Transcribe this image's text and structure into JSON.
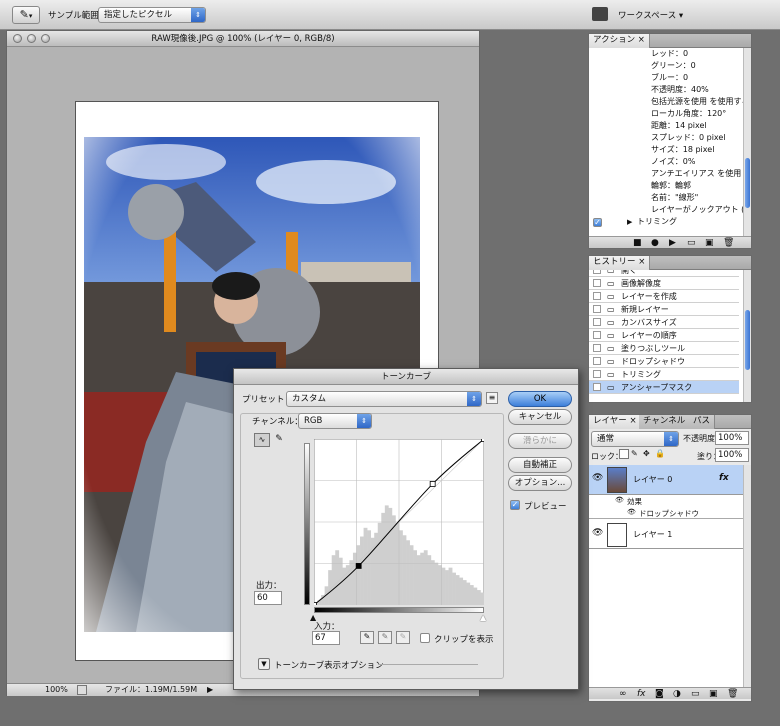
{
  "options_bar": {
    "sample_label": "サンプル範囲：",
    "sample_value": "指定したピクセル",
    "workspace_label": "ワークスペース ▾"
  },
  "document": {
    "title": "RAW現像後.JPG @ 100% (レイヤー 0, RGB/8)",
    "zoom": "100%",
    "file_info": "ファイル：1.19M/1.59M"
  },
  "actions_panel": {
    "tab_label": "アクション",
    "rows": [
      "レッド：0",
      "グリーン：0",
      "ブルー：0",
      "不透明度：40%",
      "包括光源を使用 を使用する",
      "ローカル角度：120°",
      "距離：14 pixel",
      "スプレッド：0 pixel",
      "サイズ：18 pixel",
      "ノイズ：0%",
      "アンチエイリアス を使用し...",
      "輪郭：輪郭",
      "名前：\"線形\"",
      "レイヤーがノックアウト (抜..."
    ],
    "action_item": "トリミング"
  },
  "history_panel": {
    "tab_label": "ヒストリー",
    "items": [
      "開く",
      "画像解像度",
      "レイヤーを作成",
      "新規レイヤー",
      "カンバスサイズ",
      "レイヤーの順序",
      "塗りつぶしツール",
      "ドロップシャドウ",
      "トリミング",
      "アンシャープマスク"
    ],
    "selected_index": 9
  },
  "layers_panel": {
    "tabs": [
      "レイヤー",
      "チャンネル",
      "パス"
    ],
    "blend_mode": "通常",
    "opacity_label": "不透明度：",
    "opacity_value": "100%",
    "lock_label": "ロック：",
    "fill_label": "塗り：",
    "fill_value": "100%",
    "layer0_name": "レイヤー 0",
    "fx_label": "fx",
    "effects_label": "効果",
    "dropshadow_label": "ドロップシャドウ",
    "layer1_name": "レイヤー 1"
  },
  "curves_dialog": {
    "title": "トーンカーブ",
    "preset_label": "プリセット：",
    "preset_value": "カスタム",
    "channel_label": "チャンネル：",
    "channel_value": "RGB",
    "output_label": "出力：",
    "output_value": "60",
    "input_label": "入力：",
    "input_value": "67",
    "clip_label": "クリップを表示",
    "options_label": "トーンカーブ表示オプション",
    "buttons": {
      "ok": "OK",
      "cancel": "キャンセル",
      "smooth": "滑らかに",
      "auto": "自動補正",
      "options": "オプション..."
    },
    "preview_label": "プレビュー",
    "preview_checked": true
  },
  "chart_data": {
    "type": "line",
    "xlabel": "",
    "ylabel": "",
    "xlim": [
      0,
      255
    ],
    "ylim": [
      0,
      255
    ],
    "curve_points": [
      [
        0,
        0
      ],
      [
        67,
        60
      ],
      [
        178,
        186
      ],
      [
        255,
        255
      ]
    ],
    "histogram_series": [
      {
        "values": [
          2,
          4,
          8,
          15,
          28,
          40,
          44,
          38,
          30,
          32,
          36,
          42,
          48,
          55,
          62,
          60,
          54,
          58,
          66,
          74,
          80,
          78,
          72,
          66,
          60,
          56,
          52,
          48,
          44,
          40,
          42,
          44,
          40,
          36,
          34,
          32,
          30,
          28,
          30,
          26,
          24,
          22,
          20,
          18,
          16,
          14,
          12,
          10
        ]
      }
    ]
  },
  "colors": {
    "accent_blue": "#3d7fda",
    "selection_blue": "#b9d2f5",
    "panel_bg": "#e9e9e9"
  }
}
